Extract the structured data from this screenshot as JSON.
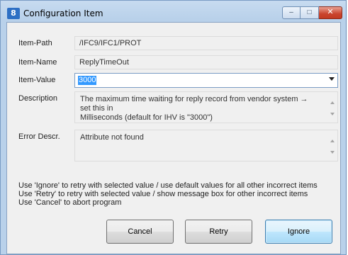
{
  "window": {
    "title": "Configuration Item",
    "icon_text": "8"
  },
  "captions": {
    "minimize_glyph": "–",
    "maximize_glyph": "□",
    "close_glyph": "✕"
  },
  "fields": {
    "item_path": {
      "label": "Item-Path",
      "value": "/IFC9/IFC1/PROT"
    },
    "item_name": {
      "label": "Item-Name",
      "value": "ReplyTimeOut"
    },
    "item_value": {
      "label": "Item-Value",
      "value": "3000"
    },
    "description": {
      "label": "Description",
      "line1": "The maximum time waiting for reply record from vendor system → set this in",
      "line2": "Milliseconds (default for IHV is \"3000\")"
    },
    "error": {
      "label": "Error Descr.",
      "value": "Attribute not found"
    }
  },
  "help": {
    "line1": "Use 'Ignore' to retry with selected value / use default values for all other incorrect items",
    "line2": "Use 'Retry' to retry with selected value / show message box for other incorrect items",
    "line3": "Use 'Cancel' to abort program"
  },
  "buttons": {
    "cancel": "Cancel",
    "retry": "Retry",
    "ignore": "Ignore"
  }
}
